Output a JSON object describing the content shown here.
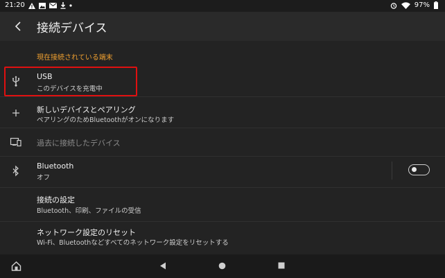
{
  "status_bar": {
    "time": "21:20",
    "left_icons": [
      "warning-icon",
      "image-icon",
      "mail-icon",
      "download-icon",
      "dot-icon"
    ],
    "right_icons": [
      "alarm-icon",
      "wifi-icon"
    ],
    "battery_text": "97%"
  },
  "app_bar": {
    "title": "接続デバイス"
  },
  "list": {
    "section_header": "現在接続されている端末",
    "items": [
      {
        "title": "USB",
        "subtitle": "このデバイスを充電中",
        "icon": "usb-icon"
      },
      {
        "title": "新しいデバイスとペアリング",
        "subtitle": "ペアリングのためBluetoothがオンになります",
        "icon": "plus-icon"
      },
      {
        "title": "過去に接続したデバイス",
        "subtitle": "",
        "icon": "devices-icon"
      },
      {
        "title": "Bluetooth",
        "subtitle": "オフ",
        "icon": "bluetooth-icon",
        "toggle_on": false
      },
      {
        "title": "接続の設定",
        "subtitle": "Bluetooth、印刷、ファイルの受信",
        "icon": ""
      },
      {
        "title": "ネットワーク設定のリセット",
        "subtitle": "Wi-Fi、Bluetoothなどすべてのネットワーク設定をリセットする",
        "icon": ""
      }
    ]
  },
  "colors": {
    "background": "#232323",
    "app_bar": "#2a2a2a",
    "accent": "#f0a030",
    "highlight": "#e01010",
    "disabled_text": "#8a8a8a"
  },
  "nav_bar": {
    "icons": [
      "home-icon",
      "back-triangle-icon",
      "home-circle-icon",
      "recents-square-icon"
    ]
  }
}
